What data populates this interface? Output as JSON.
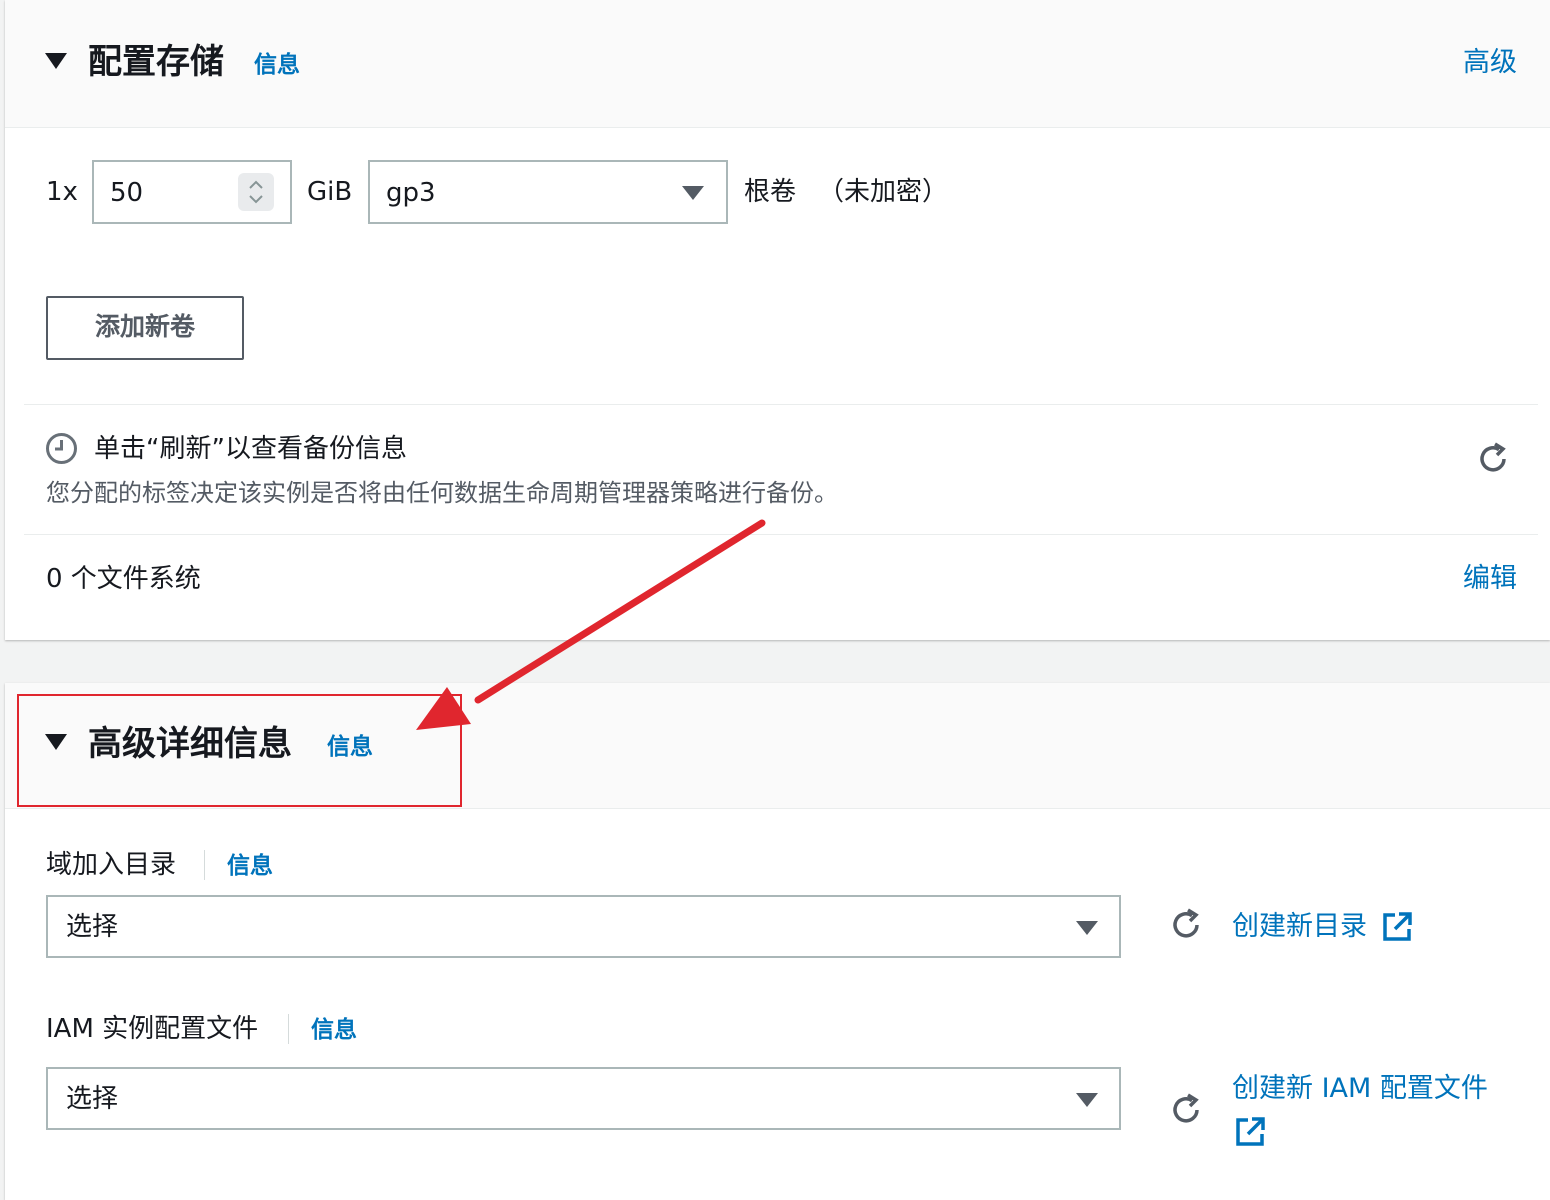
{
  "storage": {
    "title": "配置存储",
    "info": "信息",
    "advanced_link": "高级",
    "volume": {
      "count": "1x",
      "size_value": "50",
      "unit": "GiB",
      "type_value": "gp3",
      "root_label": "根卷",
      "encryption": "（未加密）"
    },
    "add_volume_button": "添加新卷",
    "backup": {
      "title": "单击“刷新”以查看备份信息",
      "description": "您分配的标签决定该实例是否将由任何数据生命周期管理器策略进行备份。"
    },
    "filesystems": {
      "label": "0 个文件系统",
      "edit_link": "编辑"
    }
  },
  "advanced": {
    "title": "高级详细信息",
    "info": "信息",
    "domain_join": {
      "label": "域加入目录",
      "info": "信息",
      "select_value": "选择",
      "create_link": "创建新目录"
    },
    "iam_profile": {
      "label": "IAM 实例配置文件",
      "info": "信息",
      "select_value": "选择",
      "create_link": "创建新 IAM 配置文件"
    }
  },
  "colors": {
    "link": "#0073bb",
    "annotation": "#e0262e",
    "text": "#16191f",
    "muted": "#545b64"
  },
  "icons": [
    "collapse-caret-icon",
    "clock-icon",
    "refresh-icon",
    "external-link-icon",
    "spinner-icon",
    "dropdown-caret-icon",
    "annotation-arrow"
  ]
}
